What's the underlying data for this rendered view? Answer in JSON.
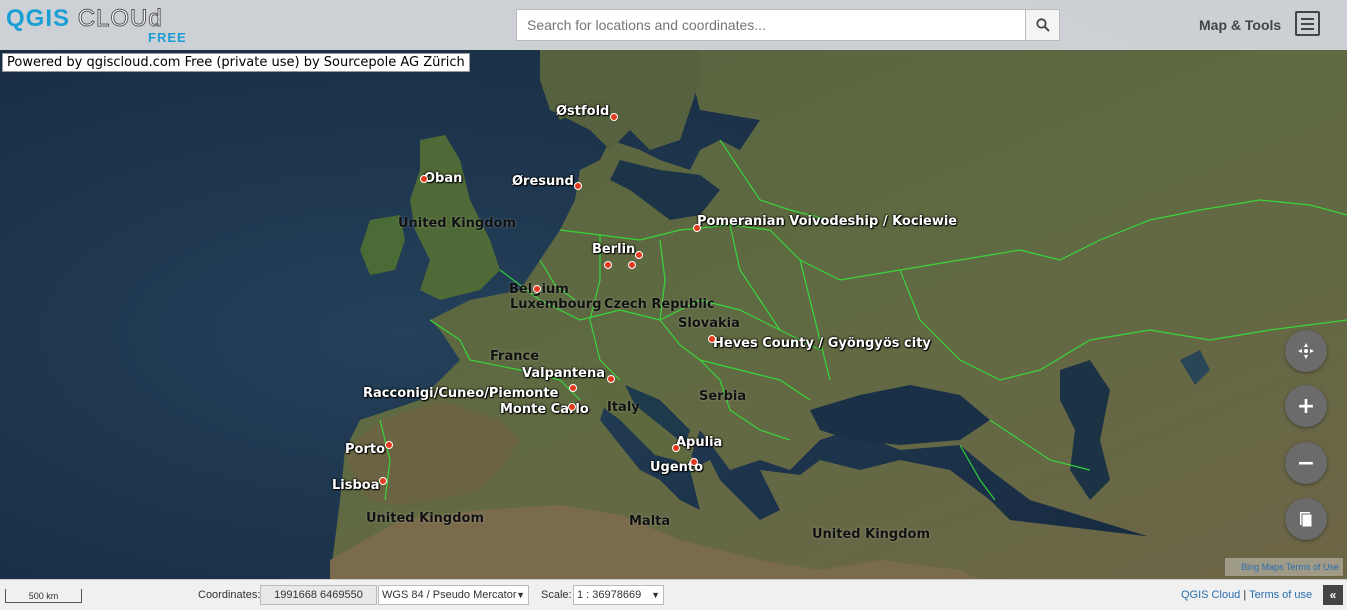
{
  "header": {
    "logo_main": "QGIS",
    "logo_cloud": "CLOUd",
    "logo_sub": "FREE",
    "search_placeholder": "Search for locations and coordinates...",
    "search_icon": "magnifier-icon",
    "map_tools_label": "Map & Tools",
    "menu_icon": "hamburger-icon"
  },
  "attribution": "Powered by qgiscloud.com Free (private use) by Sourcepole AG Zürich",
  "map_labels": [
    {
      "text": "Østfold",
      "style": "white"
    },
    {
      "text": "Oban",
      "style": "white"
    },
    {
      "text": "Øresund",
      "style": "white"
    },
    {
      "text": "United Kingdom",
      "style": "black"
    },
    {
      "text": "Pomeranian Voivodeship / Kociewie",
      "style": "white"
    },
    {
      "text": "Berlin",
      "style": "white"
    },
    {
      "text": "Belgium",
      "style": "black"
    },
    {
      "text": "Luxembourg",
      "style": "black"
    },
    {
      "text": "Czech Republic",
      "style": "black"
    },
    {
      "text": "Slovakia",
      "style": "black"
    },
    {
      "text": "Heves County / Gyöngyös city",
      "style": "white"
    },
    {
      "text": "France",
      "style": "black"
    },
    {
      "text": "Valpantena",
      "style": "white"
    },
    {
      "text": "Racconigi/Cuneo/Piemonte",
      "style": "white"
    },
    {
      "text": "Monte Carlo",
      "style": "white"
    },
    {
      "text": "Italy",
      "style": "black"
    },
    {
      "text": "Serbia",
      "style": "black"
    },
    {
      "text": "Apulia",
      "style": "white"
    },
    {
      "text": "Ugento",
      "style": "white"
    },
    {
      "text": "Porto",
      "style": "white"
    },
    {
      "text": "Lisboa",
      "style": "white"
    },
    {
      "text": "United Kingdom",
      "style": "black"
    },
    {
      "text": "Malta",
      "style": "black"
    },
    {
      "text": "United Kingdom",
      "style": "black"
    }
  ],
  "controls": {
    "locate_icon": "crosshair-icon",
    "zoom_in": "+",
    "zoom_out": "−",
    "layers_icon": "book-icon"
  },
  "bing_terms": "Bing Maps Terms of Use",
  "footer": {
    "scale_bar": "500 km",
    "coordinates_label": "Coordinates:",
    "coordinates_value": "1991668 6469550",
    "projection": "WGS 84 / Pseudo Mercator",
    "scale_label": "Scale:",
    "scale_value": "1 : 36978669",
    "link_qgis_cloud": "QGIS Cloud",
    "link_terms": "Terms of use",
    "collapse": "«"
  },
  "colors": {
    "sea": "#1d3344",
    "land": "#4b5a36",
    "border": "#35e03a",
    "marker": "#e23a1c",
    "accent": "#1a9fd5"
  }
}
